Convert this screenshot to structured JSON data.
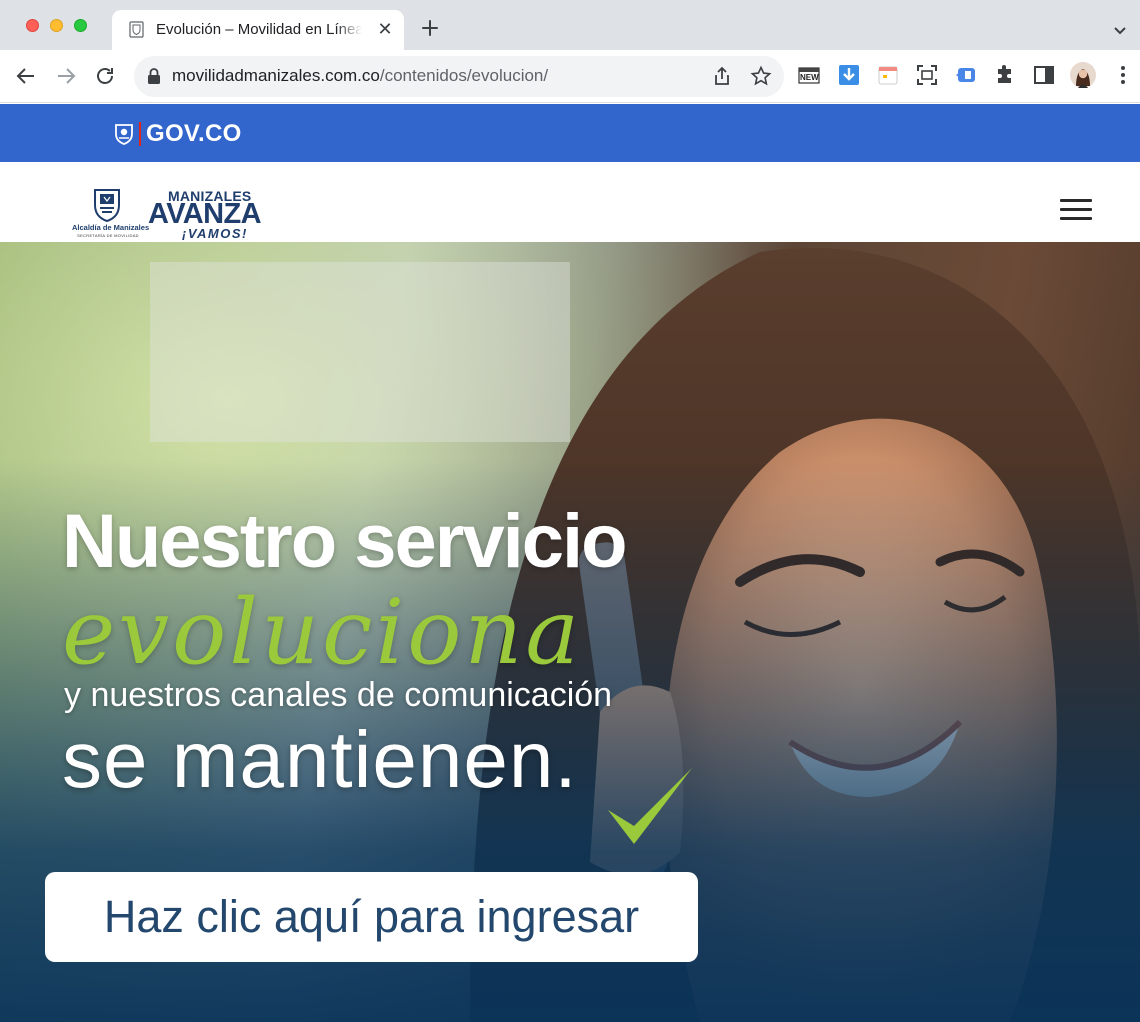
{
  "browser": {
    "tab_title": "Evolución – Movilidad en Línea",
    "url_domain": "movilidadmanizales.com.co",
    "url_path": "/contenidos/evolucion/",
    "extension_new_badge": "NEW"
  },
  "gov_bar": {
    "label": "GOV.CO"
  },
  "header": {
    "alcaldia_name": "Alcaldía de Manizales",
    "alcaldia_sub": "SECRETARÍA DE MOVILIDAD",
    "brand_top": "MANIZALES",
    "brand_main": "AVANZA",
    "brand_sub": "¡VAMOS!"
  },
  "hero": {
    "line1": "Nuestro servicio",
    "line2": "evoluciona",
    "line3": "y nuestros canales de comunicación",
    "line4": "se mantienen.",
    "cta_label": "Haz clic aquí para ingresar"
  },
  "colors": {
    "gov_blue": "#3366cc",
    "brand_navy": "#1f3e6d",
    "accent_green": "#9bc93c",
    "cta_text": "#24486d"
  },
  "icons": [
    "back-icon",
    "forward-icon",
    "reload-icon",
    "lock-icon",
    "share-icon",
    "star-icon",
    "extensions-icon",
    "sidepanel-icon",
    "profile-avatar",
    "menu-icon",
    "hamburger-icon",
    "checkmark-icon"
  ]
}
